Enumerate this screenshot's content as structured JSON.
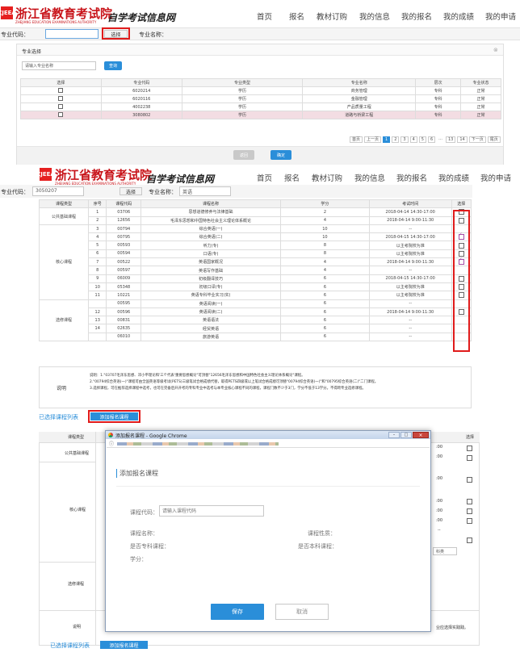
{
  "brand": {
    "name": "浙江省教育考试院",
    "sub": "ZHEJIANG EDUCATION EXAMINATIONS AUTHORITY",
    "title": "自学考试信息网",
    "logo": "ZJEEA"
  },
  "nav": [
    "首页",
    "报名",
    "教材订购",
    "我的信息",
    "我的报名",
    "我的成绩",
    "我的申请"
  ],
  "panel1": {
    "code_label": "专业代码：",
    "code_value": "",
    "select_btn": "选择",
    "name_label": "专业名称：",
    "dialog_title": "专业选择",
    "close_icon": "close-icon",
    "search_placeholder": "请输入专业名称",
    "search_btn": "查询",
    "columns": [
      "选择",
      "专业代码",
      "专业类型",
      "专业名称",
      "层次",
      "专业状态"
    ],
    "rows": [
      [
        "",
        "6020214",
        "学历",
        "商务管理",
        "专科",
        "正常"
      ],
      [
        "",
        "6020116",
        "学历",
        "金融管理",
        "专科",
        "正常"
      ],
      [
        "",
        "4002238",
        "学历",
        "产品质量工程",
        "专科",
        "正常"
      ],
      [
        "",
        "3080802",
        "学历",
        "道路与桥梁工程",
        "专科",
        "正常"
      ]
    ],
    "pager": {
      "first": "首页",
      "prev": "上一页",
      "pages": [
        "1",
        "2",
        "3",
        "4",
        "5",
        "6",
        "...",
        "13",
        "14"
      ],
      "next": "下一页",
      "last": "尾页"
    },
    "back_btn": "返回",
    "confirm_btn": "确定"
  },
  "panel2": {
    "code_label": "专业代码：",
    "code_value": "3050207",
    "select_btn": "选择",
    "name_label": "专业名称：",
    "name_value": "英语",
    "columns": [
      "课程类型",
      "序号",
      "课程代码",
      "课程名称",
      "学分",
      "考试时间",
      "选择"
    ],
    "rows": [
      {
        "type": "公共基础课程",
        "no": "1",
        "code": "03706",
        "name": "思想道德修养与法律基础",
        "credit": "2",
        "time": "2018-04-14 14:30-17:00",
        "check": "off"
      },
      {
        "type": "",
        "no": "2",
        "code": "12656",
        "name": "毛泽东思想和中国特色社会主义理论体系概论",
        "credit": "4",
        "time": "2018-04-14 9:00-11:30",
        "check": "off"
      },
      {
        "type": "",
        "no": "3",
        "code": "00794",
        "name": "综合英语(一)",
        "credit": "10",
        "time": "--",
        "check": ""
      },
      {
        "type": "",
        "no": "4",
        "code": "00795",
        "name": "综合英语(二)",
        "credit": "10",
        "time": "2018-04-15 14:30-17:00",
        "check": "on"
      },
      {
        "type": "",
        "no": "5",
        "code": "00593",
        "name": "听力(专)",
        "credit": "8",
        "time": "以主考院校为准",
        "check": "off"
      },
      {
        "type": "",
        "no": "6",
        "code": "00594",
        "name": "口语(专)",
        "credit": "8",
        "time": "以主考院校为准",
        "check": "off"
      },
      {
        "type": "核心课程",
        "no": "7",
        "code": "00522",
        "name": "英语国家概况",
        "credit": "4",
        "time": "2018-04-14 9:00-11:30",
        "check": "on"
      },
      {
        "type": "",
        "no": "8",
        "code": "00597",
        "name": "英语写作基础",
        "credit": "4",
        "time": "--",
        "check": ""
      },
      {
        "type": "",
        "no": "9",
        "code": "06009",
        "name": "初级翻译技巧",
        "credit": "6",
        "time": "2018-04-15 14:30-17:00",
        "check": "off"
      },
      {
        "type": "",
        "no": "10",
        "code": "05348",
        "name": "初级口译(专)",
        "credit": "6",
        "time": "以主考院校为准",
        "check": "off"
      },
      {
        "type": "",
        "no": "11",
        "code": "10221",
        "name": "英语专科毕业实习(实)",
        "credit": "6",
        "time": "以主考院校为准",
        "check": "off"
      },
      {
        "type": "",
        "no": "",
        "code": "00595",
        "name": "英语阅读(一)",
        "credit": "6",
        "time": "--",
        "check": ""
      },
      {
        "type": "",
        "no": "12",
        "code": "00596",
        "name": "英语阅读(二)",
        "credit": "6",
        "time": "2018-04-14 9:00-11:30",
        "check": "off"
      },
      {
        "type": "选修课程",
        "no": "13",
        "code": "00831",
        "name": "英语语法",
        "credit": "6",
        "time": "--",
        "check": ""
      },
      {
        "type": "",
        "no": "14",
        "code": "02635",
        "name": "经贸英语",
        "credit": "6",
        "time": "--",
        "check": ""
      },
      {
        "type": "",
        "no": "",
        "code": "06010",
        "name": "旅游英语",
        "credit": "6",
        "time": "--",
        "check": ""
      }
    ],
    "note_label": "说明",
    "note_lines": [
      "说明：1.\"03707毛泽东思想、邓小平理论和'三个代表'重要思想概论\"可顶替\"12656毛泽东思想和中国特色社会主义理论体系概论\"课程。",
      "2.\"00794综合英语(一)\"课程可由全国英语等级考试(PETS)三级笔试合格成绩代替，取得PETS四级或以上笔试合格成绩可顶替\"00794综合英语(一)\"和\"00795综合英语(二)\"二门课程。",
      "3.选择课程，可在推荐选择课程中选考，也可在完备后开开考的专科专业中选考与本专业核心课程不同的课程，课程门数不少于3门，学分不低于13学分。不得跨专业选修课程。"
    ],
    "selected_link": "已选择课程列表",
    "add_btn": "添加报名课程"
  },
  "panel3": {
    "col_type": "课程类型",
    "col_select": "选择",
    "types": [
      "公共基础课程",
      "核心课程",
      "选修课程",
      "说明"
    ],
    "side_times": [
      ":00",
      ":00",
      ":00",
      ":00",
      ":00",
      ":00"
    ],
    "side_dash": "--",
    "side_select_text": "科类",
    "side_note_tail": "业应选择实践践。",
    "selected_link": "已选择课程列表",
    "add_btn": "添加报名课程",
    "window_title": "添加报名课程 - Google Chrome",
    "info_icon": "info-icon",
    "modal_heading": "添加报名课程",
    "code_label": "课程代码：",
    "code_placeholder": "请输入课程代码",
    "name_label": "课程名称：",
    "nature_label": "课程性质：",
    "is_specialty_label": "是否专科课程：",
    "is_bachelor_label": "是否本科课程：",
    "credit_label": "学分：",
    "save_btn": "保存",
    "cancel_btn": "取消",
    "colors": {
      "accent": "#2a8ed9",
      "brand": "#c8141a",
      "highlight": "#e01b1b"
    }
  }
}
